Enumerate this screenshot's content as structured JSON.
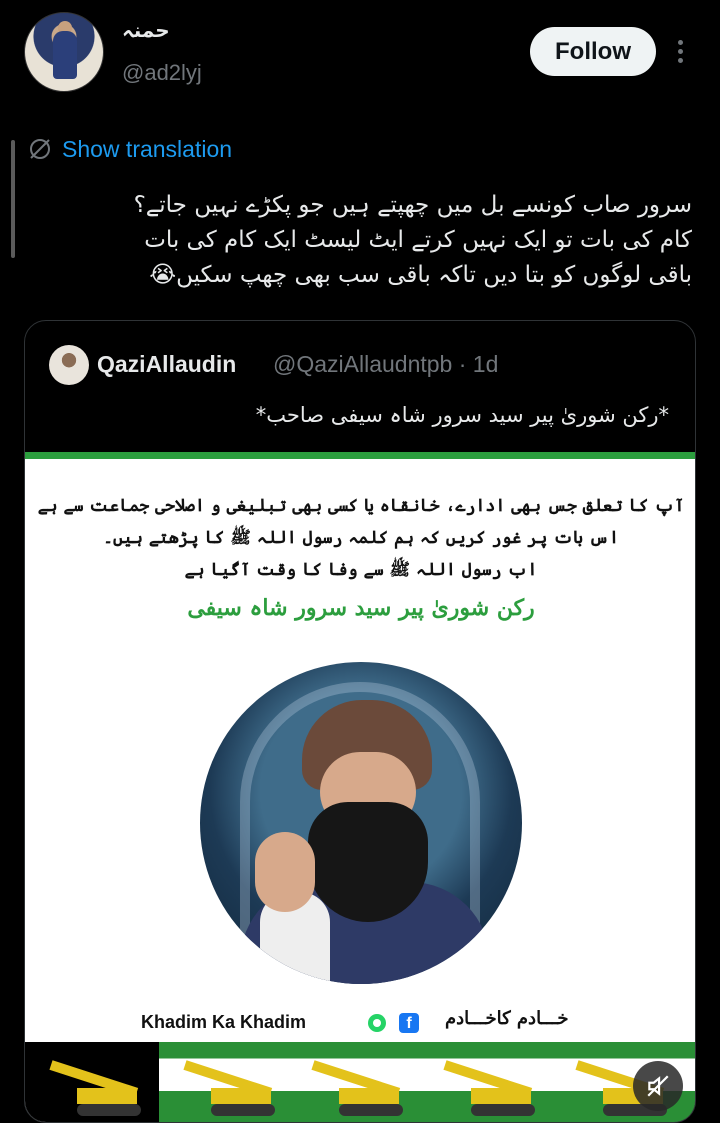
{
  "author": {
    "display_name": "حمنہ",
    "handle": "@ad2lyj"
  },
  "actions": {
    "follow_label": "Follow"
  },
  "translation": {
    "label": "Show translation"
  },
  "tweet": {
    "lines": [
      "سرور صاب کونسے بل میں چھپتے ہیں جو  پکڑے نہیں جاتے؟",
      "کام کی بات تو ایک نہیں کرتے ایٹ لیسٹ ایک کام کی بات",
      "باقی لوگوں کو بتا دیں تاکہ باقی سب بھی چھپ سکیں😭"
    ]
  },
  "quoted": {
    "name": "QaziAllaudin",
    "handle_time": "@QaziAllaudntpb · 1d",
    "text": "*رکن شوریٰ پیر سید سرور شاہ سیفی صاحب*",
    "image": {
      "lines": [
        "آپ کا تعلق جس بھی ادارے، خانقاہ یا کسی بھی تبلیغی و اصلاحی جماعت سے ہے",
        "اس بات پر غور کریں کہ ہم کلمہ رسول اللہ ﷺ کا پڑھتے ہیں۔",
        "اب رسول اللہ ﷺ سے وفا کا وقت آگیا ہے"
      ],
      "highlight": "رکن شوریٰ پیر سید سرور شاہ سیفی",
      "brand_en": "Khadim Ka Khadim",
      "brand_ur": "خـــادم کاخـــادم",
      "fb_glyph": "f"
    }
  },
  "icons": {
    "translate": "globe-slash-icon",
    "more": "more-vertical-icon",
    "mute": "muted-speaker-icon",
    "whatsapp": "whatsapp-icon",
    "facebook": "facebook-icon"
  },
  "colors": {
    "link": "#1d9bf0",
    "accent_green": "#2c9e3e"
  }
}
